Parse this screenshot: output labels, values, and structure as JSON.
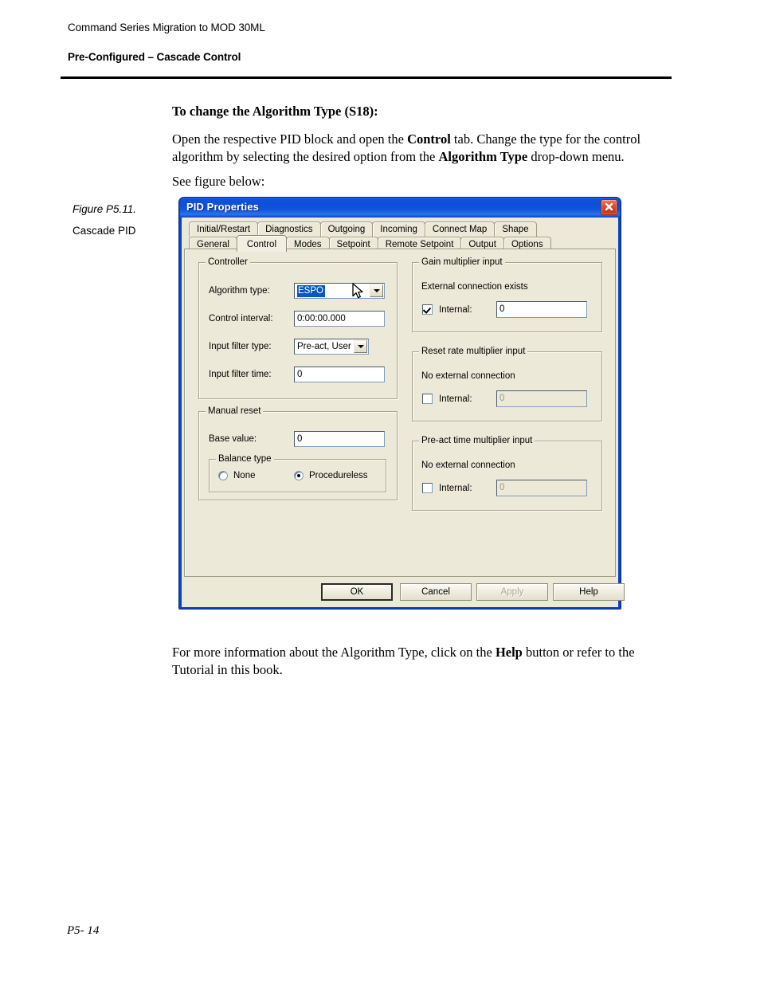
{
  "page": {
    "running_header": "Command Series Migration to MOD 30ML",
    "section_header": "Pre-Configured – Cascade Control",
    "footer": "P5- 14",
    "heading": "To change the Algorithm Type (S18):",
    "paragraph1_parts": [
      {
        "text": "Open the respective PID block and open the ",
        "bold": false
      },
      {
        "text": "Control",
        "bold": true
      },
      {
        "text": " tab. Change the type for the control algorithm by selecting the desired option from the ",
        "bold": false
      },
      {
        "text": "Algorithm Type",
        "bold": true
      },
      {
        "text": " drop-down menu.",
        "bold": false
      }
    ],
    "paragraph2": "See figure below:",
    "paragraph3_parts": [
      {
        "text": "For more information about the Algorithm Type, click on the ",
        "bold": false
      },
      {
        "text": "Help",
        "bold": true
      },
      {
        "text": " button or refer to the Tutorial in this book.",
        "bold": false
      }
    ],
    "figure_number": "Figure P5.11.",
    "figure_caption": "Cascade PID"
  },
  "dialog": {
    "title": "PID Properties",
    "close_icon": "close-x-icon",
    "accent_title_color": "#0e4fd8",
    "face_color": "#ece9d8",
    "selection_color": "#0a57c2",
    "tabs_row1": [
      {
        "label": "Initial/Restart",
        "selected": false
      },
      {
        "label": "Diagnostics",
        "selected": false
      },
      {
        "label": "Outgoing",
        "selected": false
      },
      {
        "label": "Incoming",
        "selected": false
      },
      {
        "label": "Connect Map",
        "selected": false
      },
      {
        "label": "Shape",
        "selected": false
      }
    ],
    "tabs_row2": [
      {
        "label": "General",
        "selected": false
      },
      {
        "label": "Control",
        "selected": true
      },
      {
        "label": "Modes",
        "selected": false
      },
      {
        "label": "Setpoint",
        "selected": false
      },
      {
        "label": "Remote Setpoint",
        "selected": false
      },
      {
        "label": "Output",
        "selected": false
      },
      {
        "label": "Options",
        "selected": false
      }
    ],
    "controller_group": {
      "title": "Controller",
      "algorithm_type_label": "Algorithm type:",
      "algorithm_type_value": "ESPO",
      "algorithm_type_selected": true,
      "control_interval_label": "Control interval:",
      "control_interval_value": "0:00:00.000",
      "input_filter_type_label": "Input filter type:",
      "input_filter_type_value": "Pre-act, User",
      "input_filter_time_label": "Input filter time:",
      "input_filter_time_value": "0"
    },
    "manual_reset_group": {
      "title": "Manual reset",
      "base_value_label": "Base value:",
      "base_value": "0",
      "balance_type": {
        "title": "Balance type",
        "options": [
          {
            "label": "None",
            "selected": false
          },
          {
            "label": "Procedureless",
            "selected": true
          }
        ]
      }
    },
    "gain_multiplier_group": {
      "title": "Gain multiplier input",
      "connection_status": "External connection exists",
      "internal_label": "Internal:",
      "internal_checked": true,
      "internal_value": "0",
      "internal_enabled": true
    },
    "reset_rate_group": {
      "title": "Reset rate multiplier input",
      "connection_status": "No external connection",
      "internal_label": "Internal:",
      "internal_checked": false,
      "internal_value": "0",
      "internal_enabled": false
    },
    "preact_time_group": {
      "title": "Pre-act time multiplier input",
      "connection_status": "No external connection",
      "internal_label": "Internal:",
      "internal_checked": false,
      "internal_value": "0",
      "internal_enabled": false
    },
    "buttons": {
      "ok": "OK",
      "cancel": "Cancel",
      "apply": "Apply",
      "apply_disabled": true,
      "help": "Help"
    }
  }
}
